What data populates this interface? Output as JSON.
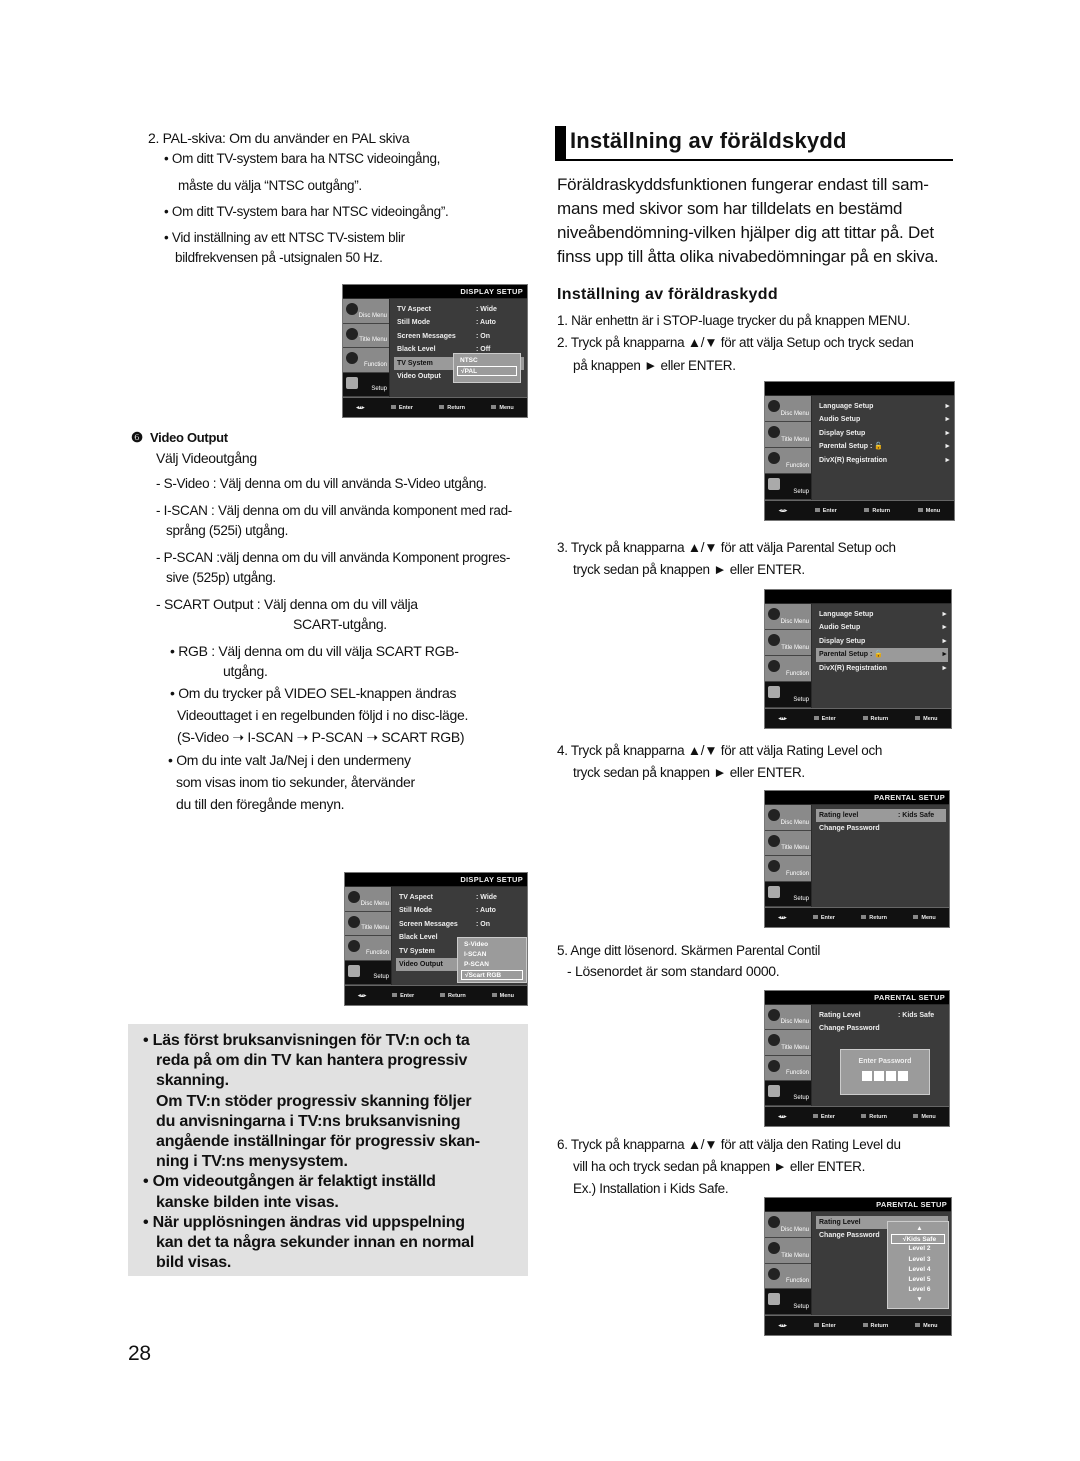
{
  "left": {
    "pal_heading": "2. PAL-skiva: Om du använder en PAL skiva",
    "bullet1a": "• Om ditt TV-system bara ha NTSC videoingång,",
    "bullet1b": "måste du välja “NTSC outgång”.",
    "bullet2": "• Om ditt TV-system bara har NTSC videoingång”.",
    "bullet3a": "• Vid inställning av ett NTSC TV-sistem blir",
    "bullet3b": "bildfrekvensen på -utsignalen 50 Hz.",
    "video_output_num": "❻",
    "video_output_title": "Video Output",
    "video_output_sub": "Välj Videoutgång",
    "svideo": "- S-Video : Välj denna om du vill använda S-Video utgång.",
    "iscan_a": "- I-SCAN : Välj denna om du vill använda komponent med rad-",
    "iscan_b": "språng (525i) utgång.",
    "pscan_a": "- P-SCAN :välj denna om du vill använda Komponent progres-",
    "pscan_b": "sive (525p) utgång.",
    "scart_a": "- SCART Output : Välj denna om du vill välja",
    "scart_b": "SCART-utgång.",
    "rgb_a": "• RGB : Välj denna om du vill välja SCART RGB-",
    "rgb_b": "utgång.",
    "sel_a": "• Om du trycker på VIDEO SEL-knappen ändras",
    "sel_b": "Videouttaget i en regelbunden följd i no disc-läge.",
    "sel_c": "(S-Video ➝ I-SCAN ➝ P-SCAN ➝ SCART RGB)",
    "yn_a": "• Om du inte valt Ja/Nej i den undermeny",
    "yn_b": "som visas inom tio sekunder, återvänder",
    "yn_c": "du till den föregånde menyn."
  },
  "note": {
    "lines": [
      "• Läs först bruksanvisningen för TV:n och ta",
      "reda på om din TV kan hantera progressiv",
      "skanning.",
      "Om TV:n stöder progressiv skanning följer",
      "du anvisningarna i TV:ns bruksanvisning",
      "angående inställningar för progressiv skan-",
      "ning i TV:ns menysystem.",
      "• Om videoutgången är felaktigt inställd",
      "kanske bilden inte visas.",
      "• När upplösningen ändras vid uppspelning",
      "kan det ta några sekunder innan en normal",
      "bild visas."
    ]
  },
  "page_number": "28",
  "right": {
    "title": "Inställning av föräldskydd",
    "intro": [
      "Föräldraskyddsfunktionen fungerar endast till sam-",
      "mans med skivor som har tilldelats en bestämd",
      "niveåbendömning-vilken hjälper dig att tittar på. Det",
      "finss upp till åtta olika nivabedömningar på en skiva."
    ],
    "subtitle": "Inställning av föräldraskydd",
    "step1": "1. När enhettn är i STOP-luage trycker du på knappen MENU.",
    "step2a": "2. Tryck på knapparna ▲/▼ för att välja Setup och tryck sedan",
    "step2b": "på knappen ► eller ENTER.",
    "step3a": "3. Tryck på knapparna ▲/▼ för att välja Parental Setup och",
    "step3b": "tryck sedan på knappen ► eller ENTER.",
    "step4a": "4. Tryck på knapparna ▲/▼ för att välja Rating Level  och",
    "step4b": "tryck sedan på knappen ► eller ENTER.",
    "step5a": "5. Ange ditt lösenord. Skärmen Parental Contil",
    "step5b": "- Lösenordet är som standard 0000.",
    "step6a": "6. Tryck på knapparna ▲/▼ för att välja den Rating Level du",
    "step6b": "vill ha och tryck sedan på knappen ► eller ENTER.",
    "step6c": "Ex.) Installation i  Kids Safe."
  },
  "osd_common": {
    "tabs": [
      "Disc Menu",
      "Title Menu",
      "Function",
      "Setup"
    ],
    "enter": "Enter",
    "return": "Return",
    "menu": "Menu",
    "nav": "◂▴▸"
  },
  "screens": [
    {
      "title": "DISPLAY SETUP",
      "rows": [
        {
          "k": "TV Aspect",
          "v": ": Wide"
        },
        {
          "k": "Still Mode",
          "v": ": Auto"
        },
        {
          "k": "Screen Messages",
          "v": ": On"
        },
        {
          "k": "Black Level",
          "v": ": Off"
        },
        {
          "k": "TV System",
          "v": "",
          "hl": true
        },
        {
          "k": "Video Output",
          "v": ""
        }
      ],
      "popup": [
        "NTSC",
        "√PAL"
      ],
      "popup_sel": 1
    },
    {
      "title": "DISPLAY SETUP",
      "rows": [
        {
          "k": "TV Aspect",
          "v": ": Wide"
        },
        {
          "k": "Still Mode",
          "v": ": Auto"
        },
        {
          "k": "Screen Messages",
          "v": ": On"
        },
        {
          "k": "Black Level",
          "v": ""
        },
        {
          "k": "TV System",
          "v": ""
        },
        {
          "k": "Video Output",
          "v": "",
          "hl": true
        }
      ],
      "popup": [
        "S-Video",
        "I-SCAN",
        "P-SCAN",
        "√Scart RGB"
      ],
      "popup_sel": 3
    },
    {
      "title": "",
      "rows": [
        {
          "k": "Language Setup",
          "a": "►"
        },
        {
          "k": "Audio Setup",
          "a": "►"
        },
        {
          "k": "Display Setup",
          "a": "►"
        },
        {
          "k": "Parental Setup :  🔓",
          "a": "►"
        },
        {
          "k": "DivX(R) Registration",
          "a": "►"
        }
      ]
    },
    {
      "title": "",
      "rows": [
        {
          "k": "Language Setup",
          "a": "►"
        },
        {
          "k": "Audio Setup",
          "a": "►"
        },
        {
          "k": "Display Setup",
          "a": "►"
        },
        {
          "k": "Parental Setup :  🔓",
          "a": "►",
          "hl": true
        },
        {
          "k": "DivX(R) Registration",
          "a": "►"
        }
      ]
    },
    {
      "title": "PARENTAL SETUP",
      "rows": [
        {
          "k": "Rating level",
          "v": ": Kids Safe",
          "hl": true
        },
        {
          "k": "Change Password",
          "v": ""
        }
      ]
    },
    {
      "title": "PARENTAL SETUP",
      "rows": [
        {
          "k": "Rating Level",
          "v": ": Kids Safe"
        },
        {
          "k": "Change Password",
          "v": ""
        }
      ],
      "password": "Enter Password"
    },
    {
      "title": "PARENTAL SETUP",
      "rows": [
        {
          "k": "Rating Level",
          "v": "",
          "hl": true
        },
        {
          "k": "Change Password",
          "v": ""
        }
      ],
      "popup": [
        "▲",
        "√Kids Safe",
        "Level 2",
        "Level 3",
        "Level 4",
        "Level 5",
        "Level 6",
        "▼"
      ],
      "popup_sel": 1
    }
  ]
}
